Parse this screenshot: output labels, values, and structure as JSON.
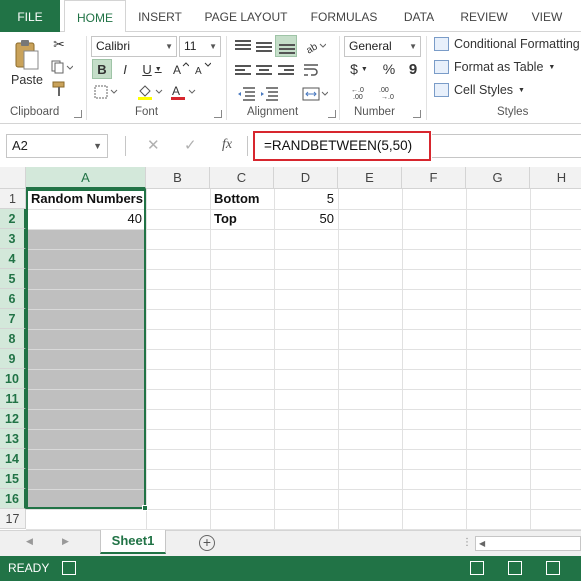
{
  "ribbon": {
    "tabs": [
      "FILE",
      "HOME",
      "INSERT",
      "PAGE LAYOUT",
      "FORMULAS",
      "DATA",
      "REVIEW",
      "VIEW"
    ],
    "active_tab": "HOME",
    "clipboard": {
      "paste_label": "Paste",
      "group_label": "Clipboard"
    },
    "font": {
      "family": "Calibri",
      "size": "11",
      "bold": "B",
      "italic": "I",
      "underline": "U",
      "group_label": "Font"
    },
    "alignment": {
      "group_label": "Alignment"
    },
    "number": {
      "format": "General",
      "currency": "$",
      "percent": "%",
      "comma": "9",
      "group_label": "Number"
    },
    "styles": {
      "conditional": "Conditional Formatting",
      "format_table": "Format as Table",
      "cell_styles": "Cell Styles",
      "group_label": "Styles"
    }
  },
  "formula_bar": {
    "name_box": "A2",
    "fx": "fx",
    "formula": "=RANDBETWEEN(5,50)"
  },
  "grid": {
    "columns": [
      "A",
      "B",
      "C",
      "D",
      "E",
      "F",
      "G",
      "H"
    ],
    "rows": [
      "1",
      "2",
      "3",
      "4",
      "5",
      "6",
      "7",
      "8",
      "9",
      "10",
      "11",
      "12",
      "13",
      "14",
      "15",
      "16",
      "17"
    ],
    "cells": {
      "A1": "Random Numbers",
      "A2": "40",
      "C1": "Bottom",
      "D1": "5",
      "C2": "Top",
      "D2": "50"
    }
  },
  "sheets": {
    "active": "Sheet1"
  },
  "status": {
    "text": "READY"
  },
  "colors": {
    "accent": "#217346",
    "formula_highlight": "#d7262e",
    "selection_fill": "#bfbfbf"
  }
}
